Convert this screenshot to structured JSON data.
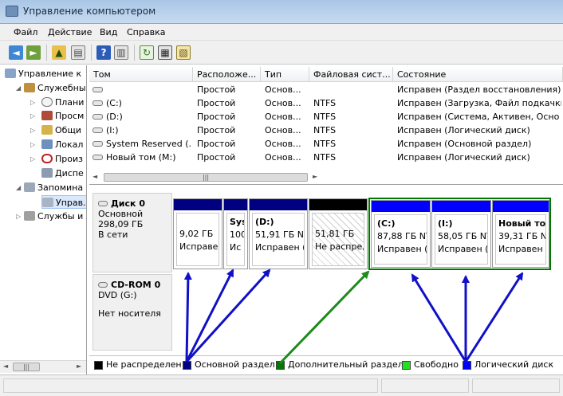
{
  "window": {
    "title": "Управление компьютером"
  },
  "menu": [
    "Файл",
    "Действие",
    "Вид",
    "Справка"
  ],
  "tree": [
    {
      "label": "Управление к",
      "level": 0,
      "expanded": true
    },
    {
      "label": "Служебны",
      "level": 1,
      "expanded": true
    },
    {
      "label": "Плани",
      "level": 2
    },
    {
      "label": "Просм",
      "level": 2
    },
    {
      "label": "Общи",
      "level": 2
    },
    {
      "label": "Локал",
      "level": 2
    },
    {
      "label": "Произ",
      "level": 2
    },
    {
      "label": "Диспе",
      "level": 2
    },
    {
      "label": "Запомина",
      "level": 1,
      "expanded": true
    },
    {
      "label": "Управ.",
      "level": 2,
      "selected": true
    },
    {
      "label": "Службы и",
      "level": 1
    }
  ],
  "volumes": {
    "columns": [
      "Том",
      "Расположе...",
      "Тип",
      "Файловая сист...",
      "Состояние"
    ],
    "rows": [
      [
        "",
        "Простой",
        "Основ...",
        "",
        "Исправен (Раздел восстановления)"
      ],
      [
        "(C:)",
        "Простой",
        "Основ...",
        "NTFS",
        "Исправен (Загрузка, Файл подкачки"
      ],
      [
        "(D:)",
        "Простой",
        "Основ...",
        "NTFS",
        "Исправен (Система, Активен, Осно"
      ],
      [
        "(I:)",
        "Простой",
        "Основ...",
        "NTFS",
        "Исправен (Логический диск)"
      ],
      [
        "System Reserved (...",
        "Простой",
        "Основ...",
        "NTFS",
        "Исправен (Основной раздел)"
      ],
      [
        "Новый том (M:)",
        "Простой",
        "Основ...",
        "NTFS",
        "Исправен (Логический диск)"
      ]
    ]
  },
  "disk0": {
    "name": "Диск 0",
    "type": "Основной",
    "size": "298,09 ГБ",
    "status": "В сети",
    "partitions": [
      {
        "name": "",
        "size": "9,02 ГБ",
        "state": "Исправе"
      },
      {
        "name": "Sys",
        "size": "100",
        "state": "Ис"
      },
      {
        "name": "(D:)",
        "size": "51,91 ГБ NT",
        "state": "Исправен ("
      },
      {
        "name": "",
        "size": "51,81 ГБ",
        "state": "Не распре,"
      },
      {
        "name": "(C:)",
        "size": "87,88 ГБ NT",
        "state": "Исправен ("
      },
      {
        "name": "(I:)",
        "size": "58,05 ГБ NT",
        "state": "Исправен ("
      },
      {
        "name": "Новый то",
        "size": "39,31 ГБ NT",
        "state": "Исправен ("
      }
    ]
  },
  "cdrom": {
    "name": "CD-ROM 0",
    "type": "DVD (G:)",
    "status": "Нет носителя"
  },
  "legend": [
    "Не распределен",
    "Основной раздел",
    "Дополнительный раздел",
    "Свободно",
    "Логический диск"
  ],
  "colors": {
    "primary": "#000080",
    "logical": "#0000ff",
    "extended": "#007700",
    "free": "#22e022",
    "unallocated": "#000000",
    "annotation_blue": "#1010c8",
    "annotation_green": "#1c8a1c"
  },
  "icons": [
    "back-icon",
    "forward-icon",
    "up-folder-icon",
    "console-tree-icon",
    "help-icon",
    "view-icon",
    "refresh-icon",
    "properties-icon",
    "export-icon"
  ]
}
